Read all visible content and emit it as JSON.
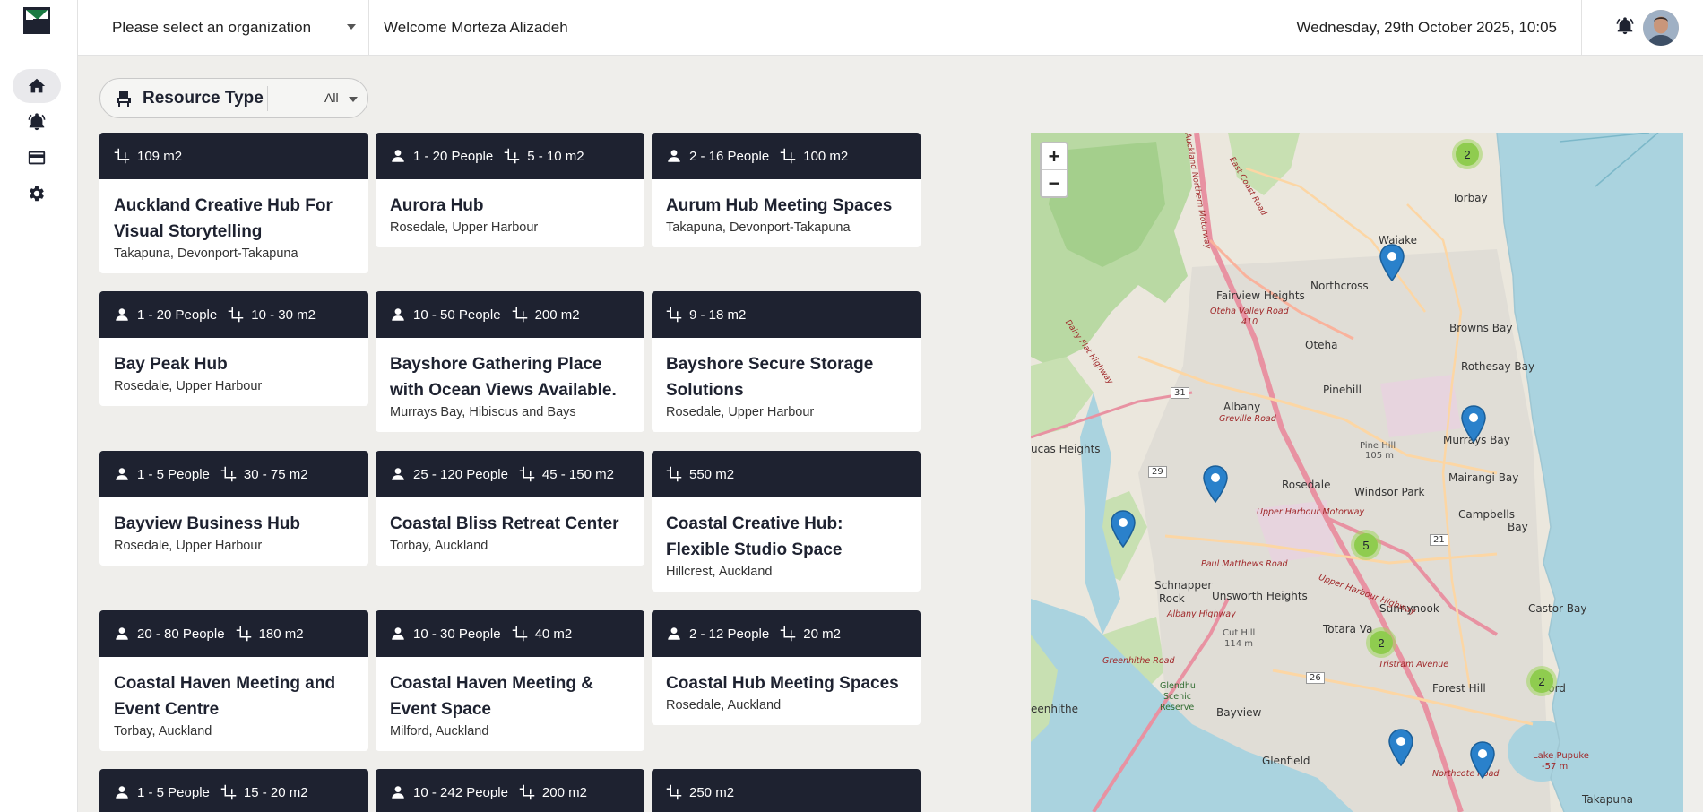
{
  "header": {
    "org_placeholder": "Please select an organization",
    "welcome": "Welcome Morteza Alizadeh",
    "datetime": "Wednesday, 29th October 2025, 10:05"
  },
  "filter": {
    "label": "Resource Type",
    "value": "All"
  },
  "cards": [
    {
      "people": "",
      "area": "109 m2",
      "title_lines": [
        "Auckland Creative Hub For",
        "Visual Storytelling"
      ],
      "location": "Takapuna, Devonport-Takapuna"
    },
    {
      "people": "1 - 20 People",
      "area": "5 - 10 m2",
      "title_lines": [
        "Aurora Hub"
      ],
      "location": "Rosedale, Upper Harbour"
    },
    {
      "people": "2 - 16 People",
      "area": "100 m2",
      "title_lines": [
        "Aurum Hub Meeting Spaces"
      ],
      "location": "Takapuna, Devonport-Takapuna"
    },
    {
      "people": "1 - 20 People",
      "area": "10 - 30 m2",
      "title_lines": [
        "Bay Peak Hub"
      ],
      "location": "Rosedale, Upper Harbour"
    },
    {
      "people": "10 - 50 People",
      "area": "200 m2",
      "title_lines": [
        "Bayshore Gathering Place",
        "with Ocean Views Available."
      ],
      "location": "Murrays Bay, Hibiscus and Bays"
    },
    {
      "people": "",
      "area": "9 - 18 m2",
      "title_lines": [
        "Bayshore Secure Storage",
        "Solutions"
      ],
      "location": "Rosedale, Upper Harbour"
    },
    {
      "people": "1 - 5 People",
      "area": "30 - 75 m2",
      "title_lines": [
        "Bayview Business Hub"
      ],
      "location": "Rosedale, Upper Harbour"
    },
    {
      "people": "25 - 120 People",
      "area": "45 - 150 m2",
      "title_lines": [
        "Coastal Bliss Retreat Center"
      ],
      "location": "Torbay, Auckland"
    },
    {
      "people": "",
      "area": "550 m2",
      "title_lines": [
        "Coastal Creative Hub:",
        "Flexible Studio Space"
      ],
      "location": "Hillcrest, Auckland"
    },
    {
      "people": "20 - 80 People",
      "area": "180 m2",
      "title_lines": [
        "Coastal Haven Meeting and",
        "Event Centre"
      ],
      "location": "Torbay, Auckland"
    },
    {
      "people": "10 - 30 People",
      "area": "40 m2",
      "title_lines": [
        "Coastal Haven Meeting &",
        "Event Space"
      ],
      "location": "Milford, Auckland"
    },
    {
      "people": "2 - 12 People",
      "area": "20 m2",
      "title_lines": [
        "Coastal Hub Meeting Spaces"
      ],
      "location": "Rosedale, Auckland"
    },
    {
      "people": "1 - 5 People",
      "area": "15 - 20 m2",
      "title_lines": [],
      "location": ""
    },
    {
      "people": "10 - 242 People",
      "area": "200 m2",
      "title_lines": [],
      "location": ""
    },
    {
      "people": "",
      "area": "250 m2",
      "title_lines": [],
      "location": ""
    }
  ],
  "map": {
    "zoom_in": "+",
    "zoom_out": "−",
    "clusters": [
      "2",
      "5",
      "2",
      "2"
    ],
    "labels": {
      "torbay": "Torbay",
      "waiake": "Waiake",
      "northcross": "Northcross",
      "fairview": "Fairview Heights",
      "oteha_valley": "Oteha Valley Road",
      "road410": "410",
      "browns_bay": "Browns Bay",
      "oteha": "Oteha",
      "rothesay": "Rothesay Bay",
      "pinehill": "Pinehill",
      "albany": "Albany",
      "greville": "Greville Road",
      "murrays_bay": "Murrays Bay",
      "lucas": "ucas Heights",
      "pine_hill": "Pine Hill",
      "pine_hill_alt": "105 m",
      "mairangi": "Mairangi Bay",
      "rosedale": "Rosedale",
      "windsor": "Windsor Park",
      "campbells": "Campbells",
      "campbells2": "Bay",
      "uh_motorway": "Upper Harbour Motorway",
      "paul_matthews": "Paul Matthews Road",
      "schnapper": "Schnapper",
      "schnapper2": "Rock",
      "unsworth": "Unsworth Heights",
      "sunnynook": "Sunnynook",
      "albany_hwy": "Albany Highway",
      "castor": "Castor Bay",
      "cut_hill": "Cut Hill",
      "cut_hill_alt": "114 m",
      "totara": "Totara Va",
      "greenhithe_rd": "Greenhithe Road",
      "glendhu": "Glendhu",
      "glendhu2": "Scenic",
      "glendhu3": "Reserve",
      "tristram": "Tristram Avenue",
      "forest_hill": "Forest Hill",
      "eenhithe": "eenhithe",
      "bayview": "Bayview",
      "ford": "ford",
      "lake_pupuke": "Lake Pupuke",
      "lake_pupuke_alt": "-57 m",
      "glenfield": "Glenfield",
      "northcote_rd": "Northcote Road",
      "takapuna": "Takapuna",
      "route31": "31",
      "route29": "29",
      "route26": "26",
      "route21": "21",
      "nth_motorway": "Auckland Northern Motorway",
      "east_coast": "East Coast Road",
      "dairy_flat": "Dairy Flat Highway",
      "uh_hwy": "Upper Harbour Highway"
    }
  },
  "colors": {
    "card_header": "#1e2230",
    "page_bg": "#efeeeb",
    "cluster": "#8fcc4f",
    "pin": "#2a81cb"
  }
}
